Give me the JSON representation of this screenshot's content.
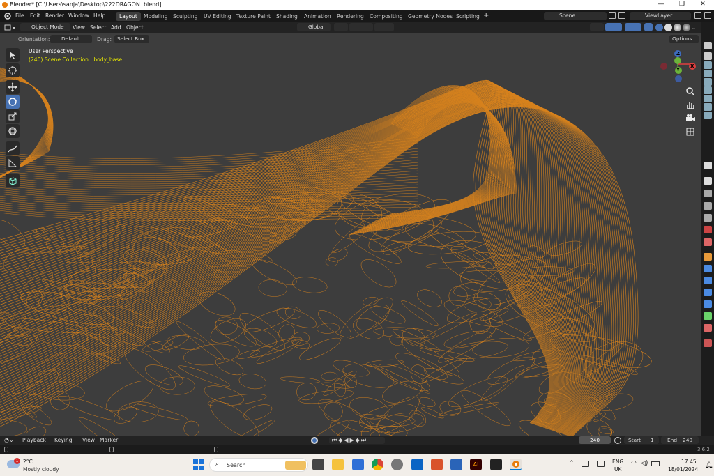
{
  "window": {
    "title": "Blender* [C:\\Users\\sanja\\Desktop\\222DRAGON .blend]",
    "minimize": "—",
    "maximize": "❐",
    "close": "✕"
  },
  "menu": [
    "File",
    "Edit",
    "Render",
    "Window",
    "Help"
  ],
  "workspaces": [
    "Layout",
    "Modeling",
    "Sculpting",
    "UV Editing",
    "Texture Paint",
    "Shading",
    "Animation",
    "Rendering",
    "Compositing",
    "Geometry Nodes",
    "Scripting"
  ],
  "workspace_add": "+",
  "scene": {
    "name": "Scene",
    "view_layer": "ViewLayer"
  },
  "header": {
    "mode": "Object Mode",
    "view": "View",
    "select": "Select",
    "add": "Add",
    "object": "Object",
    "orientation_space": "Global",
    "options": "Options"
  },
  "tool_settings": {
    "orientation_label": "Orientation:",
    "orientation_value": "Default",
    "drag_label": "Drag:",
    "drag_value": "Select Box"
  },
  "viewport": {
    "perspective": "User Perspective",
    "collection": "(240) Scene Collection | body_base"
  },
  "gizmo": {
    "x": "X",
    "y": "Y",
    "z": "Z"
  },
  "timeline": {
    "playback": "Playback",
    "keying": "Keying",
    "view": "View",
    "marker": "Marker",
    "current_frame": "240",
    "start_label": "Start",
    "start": "1",
    "end_label": "End",
    "end": "240"
  },
  "status": {
    "version": "3.6.2"
  },
  "taskbar": {
    "weather_temp": "2°C",
    "weather_desc": "Mostly cloudy",
    "weather_badge": "1",
    "search_placeholder": "Search",
    "lang1": "ENG",
    "lang2": "UK",
    "time": "17:45",
    "date": "18/01/2024"
  },
  "colors": {
    "wire": "#e88a1a",
    "accent": "#4772b3",
    "bg": "#3d3d3d"
  }
}
